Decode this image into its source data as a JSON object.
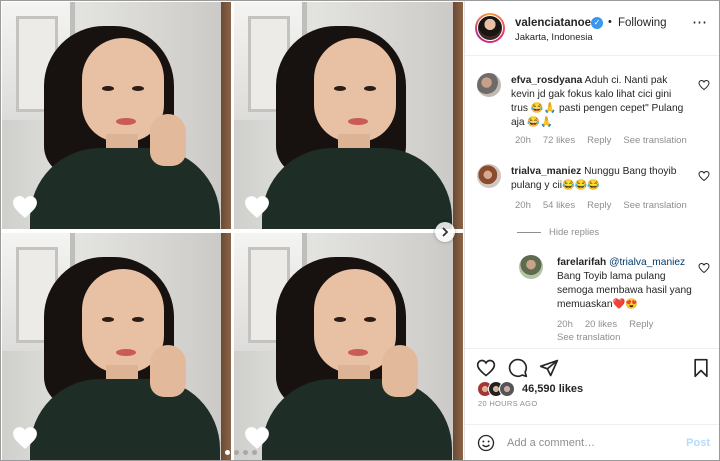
{
  "header": {
    "username": "valenciatanoe",
    "separator": "•",
    "follow_label": "Following",
    "location": "Jakarta, Indonesia",
    "more_icon": "more-horizontal-icon"
  },
  "comments": [
    {
      "username": "efva_rosdyana",
      "text": "Aduh ci. Nanti pak kevin jd gak fokus kalo lihat cici gini trus 😂🙏 pasti pengen cepet\" Pulang aja 😂🙏",
      "time": "20h",
      "likes": "72 likes",
      "reply": "Reply",
      "translate": "See translation"
    },
    {
      "username": "trialva_maniez",
      "text": "Nunggu Bang thoyib pulang y cii😂😂😂",
      "time": "20h",
      "likes": "54 likes",
      "reply": "Reply",
      "translate": "See translation"
    }
  ],
  "hide_replies": "Hide replies",
  "reply": {
    "username": "farelarifah",
    "mention": "@trialva_maniez",
    "text": "Bang Toyib lama pulang semoga membawa hasil yang memuaskan❤️😍",
    "time": "20h",
    "likes": "20 likes",
    "reply": "Reply",
    "translate": "See translation"
  },
  "likes_count": "46,590 likes",
  "time_ago": "20 HOURS AGO",
  "add_comment": {
    "placeholder": "Add a comment…",
    "post_label": "Post"
  },
  "colors": {
    "accent_blue": "#3897f0",
    "link_blue": "#00376b",
    "muted": "#8e8e8e",
    "post_disabled": "#b3dbff"
  },
  "carousel": {
    "slides": 4,
    "active_index": 0
  }
}
